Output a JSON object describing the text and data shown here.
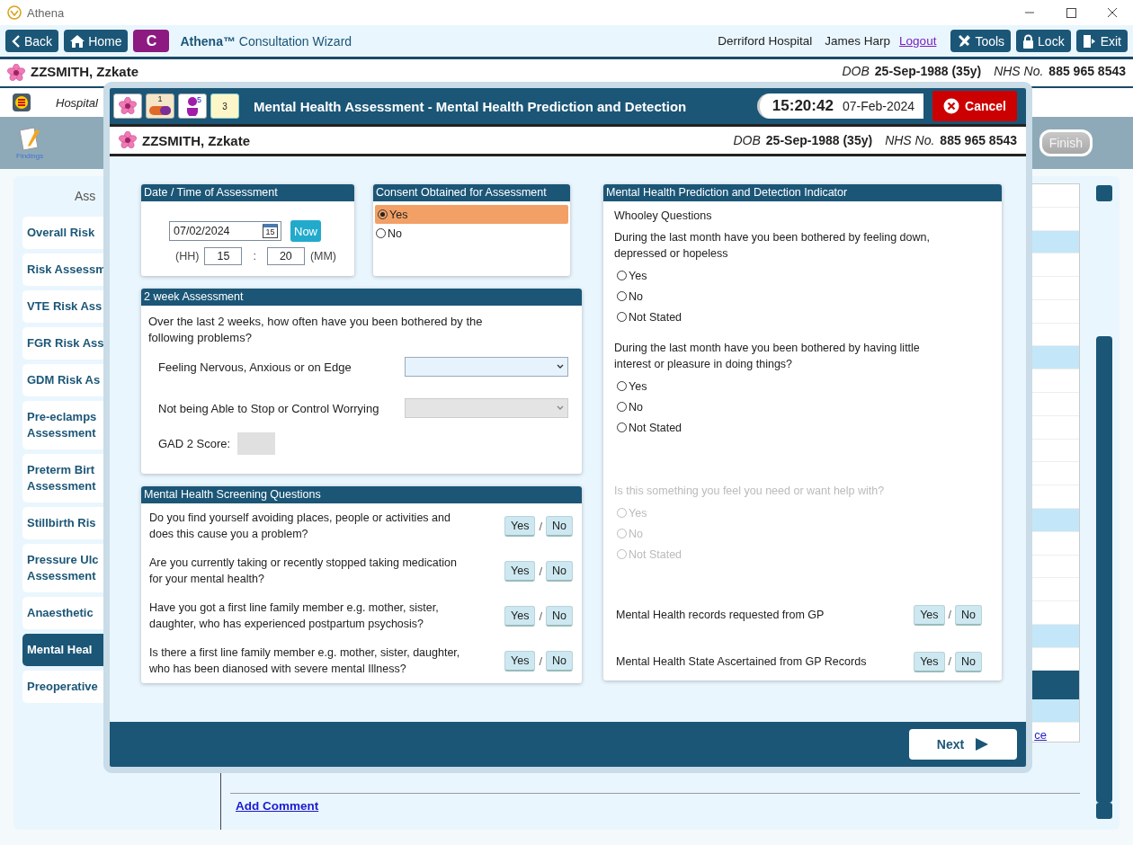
{
  "window": {
    "title": "Athena"
  },
  "toolbar": {
    "back": "Back",
    "home": "Home",
    "app_badge": "C",
    "app_name": "Athena™",
    "app_subtitle": "Consultation Wizard",
    "hospital": "Derriford Hospital",
    "user": "James Harp",
    "logout": "Logout",
    "actions": [
      {
        "kind": "tools",
        "label": "Tools"
      },
      {
        "kind": "lock",
        "label": "Lock"
      },
      {
        "kind": "exit",
        "label": "Exit"
      }
    ]
  },
  "patient": {
    "name": "ZZSMITH, Zzkate",
    "dob_label": "DOB",
    "dob": "25-Sep-1988 (35y)",
    "nhs_label": "NHS No.",
    "nhs": "885 965 8543"
  },
  "hospital_bar": {
    "text": "Hospital"
  },
  "wizard": {
    "findings": "Findings",
    "finish": "Finish"
  },
  "sidebar": {
    "heading": "Ass",
    "items": [
      {
        "label": "Overall Risk",
        "selected": false
      },
      {
        "label": "Risk Assessm",
        "selected": false
      },
      {
        "label": "VTE Risk Ass",
        "selected": false
      },
      {
        "label": "FGR Risk Ass",
        "selected": false
      },
      {
        "label": "GDM Risk As",
        "selected": false
      },
      {
        "label": "Pre-eclamps\nAssessment",
        "selected": false
      },
      {
        "label": "Preterm Birt\nAssessment",
        "selected": false
      },
      {
        "label": "Stillbirth Ris",
        "selected": false
      },
      {
        "label": "Pressure Ulc\nAssessment",
        "selected": false
      },
      {
        "label": "Anaesthetic",
        "selected": false
      },
      {
        "label": "Mental Heal",
        "selected": true
      },
      {
        "label": "Preoperative",
        "selected": false
      }
    ]
  },
  "content": {
    "link_fragment": "ce",
    "add_comment": "Add Comment"
  },
  "modal": {
    "title": "Mental Health Assessment - Mental Health Prediction and Detection",
    "badges": [
      {
        "kind": "flower"
      },
      {
        "kind": "pill",
        "count": "1"
      },
      {
        "kind": "person",
        "count": "5"
      },
      {
        "kind": "notes",
        "count": "3"
      }
    ],
    "time": "15:20:42",
    "date": "07-Feb-2024",
    "cancel": "Cancel",
    "patient": {
      "name": "ZZSMITH, Zzkate",
      "dob_label": "DOB",
      "dob": "25-Sep-1988 (35y)",
      "nhs_label": "NHS No.",
      "nhs": "885 965 8543"
    },
    "date_panel": {
      "header": "Date / Time of Assessment",
      "date": "07/02/2024",
      "calendar_day": "15",
      "now": "Now",
      "hh_label": "(HH)",
      "hh": "15",
      "colon": ":",
      "mm": "20",
      "mm_label": "(MM)"
    },
    "consent_panel": {
      "header": "Consent Obtained for Assessment",
      "options": [
        {
          "label": "Yes",
          "selected": true
        },
        {
          "label": "No",
          "selected": false
        }
      ]
    },
    "two_week_panel": {
      "header": "2 week Assessment",
      "intro": "Over the last 2 weeks, how often have you been bothered by the following problems?",
      "rows": [
        {
          "label": "Feeling Nervous, Anxious or on Edge",
          "disabled": false
        },
        {
          "label": "Not being Able to Stop or Control Worrying",
          "disabled": true
        }
      ],
      "score_label": "GAD 2 Score:"
    },
    "screening_panel": {
      "header": "Mental Health Screening Questions",
      "questions": [
        {
          "text": "Do you find yourself avoiding places, people or activities and does this cause you a problem?",
          "yes": "Yes",
          "sep": "/",
          "no": "No"
        },
        {
          "text": "Are you currently taking or recently stopped taking medication for your mental health?",
          "yes": "Yes",
          "sep": "/",
          "no": "No"
        },
        {
          "text": "Have you got a first line family member e.g. mother, sister, daughter, who has experienced postpartum psychosis?",
          "yes": "Yes",
          "sep": "/",
          "no": "No"
        },
        {
          "text": "Is there a first line family member e.g. mother, sister, daughter, who has been dianosed with severe mental Illness?",
          "yes": "Yes",
          "sep": "/",
          "no": "No"
        }
      ]
    },
    "indicator_panel": {
      "header": "Mental Health Prediction and Detection Indicator",
      "subheading": "Whooley Questions",
      "questions": [
        {
          "text": "During the last month have you been bothered by feeling down, depressed or hopeless",
          "disabled": false,
          "options": [
            {
              "label": "Yes",
              "selected": false
            },
            {
              "label": "No",
              "selected": false
            },
            {
              "label": "Not Stated",
              "selected": false
            }
          ]
        },
        {
          "text": "During the last month have you been bothered by having little interest or pleasure in doing things?",
          "disabled": false,
          "options": [
            {
              "label": "Yes",
              "selected": false
            },
            {
              "label": "No",
              "selected": false
            },
            {
              "label": "Not Stated",
              "selected": false
            }
          ]
        },
        {
          "text": "Is this something you feel you need or want help with?",
          "disabled": true,
          "options": [
            {
              "label": "Yes",
              "selected": false
            },
            {
              "label": "No",
              "selected": false
            },
            {
              "label": "Not Stated",
              "selected": false
            }
          ]
        }
      ],
      "records": [
        {
          "text": "Mental Health records requested from GP",
          "yes": "Yes",
          "sep": "/",
          "no": "No"
        },
        {
          "text": "Mental Health State Ascertained from GP Records",
          "yes": "Yes",
          "sep": "/",
          "no": "No"
        }
      ]
    },
    "next": "Next"
  }
}
